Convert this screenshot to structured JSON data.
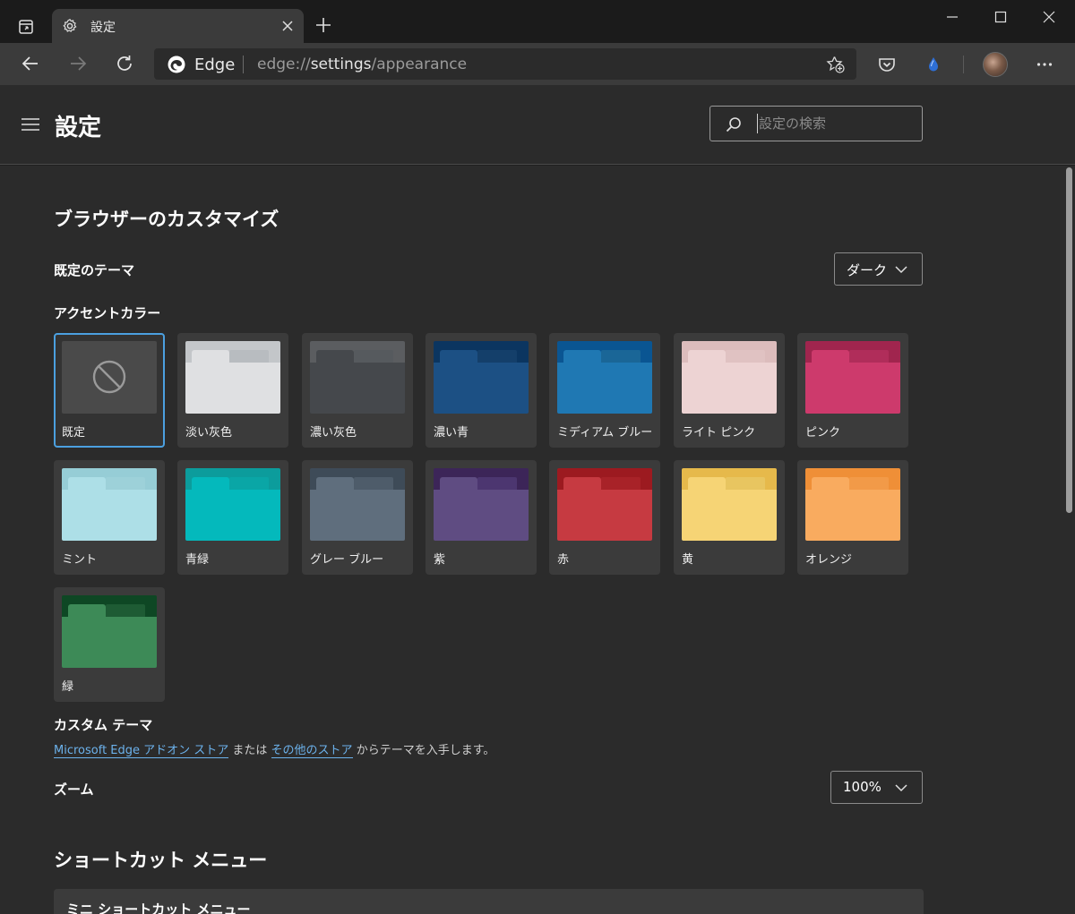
{
  "browser": {
    "tab_title": "設定",
    "brand": "Edge",
    "url_scheme": "edge://",
    "url_host": "settings",
    "url_path": "/appearance"
  },
  "header": {
    "title": "設定",
    "search_placeholder": "設定の検索"
  },
  "appearance": {
    "section_title": "ブラウザーのカスタマイズ",
    "theme_label": "既定のテーマ",
    "theme_value": "ダーク",
    "accent_label": "アクセントカラー",
    "accents": [
      {
        "label": "既定",
        "selected": true
      },
      {
        "label": "淡い灰色",
        "top": "#c3c6c9",
        "body": "#dfe0e2",
        "tab2": "#b8bcc0"
      },
      {
        "label": "濃い灰色",
        "top": "#5b5d60",
        "body": "#45484c",
        "tab2": "#565a5e"
      },
      {
        "label": "濃い青",
        "top": "#0b3560",
        "body": "#1c5084",
        "tab2": "#143f6a"
      },
      {
        "label": "ミディアム ブルー",
        "top": "#0a5592",
        "body": "#1f78b3",
        "tab2": "#1a6697"
      },
      {
        "label": "ライト ピンク",
        "top": "#dcbcbc",
        "body": "#edd3d3",
        "tab2": "#e0c2c2"
      },
      {
        "label": "ピンク",
        "top": "#a0254e",
        "body": "#cd3a6c",
        "tab2": "#b02d5a"
      },
      {
        "label": "ミント",
        "top": "#96cdd6",
        "body": "#addfe7",
        "tab2": "#9dd1d9"
      },
      {
        "label": "青緑",
        "top": "#0c9c9c",
        "body": "#04b9bc",
        "tab2": "#0aa6a6"
      },
      {
        "label": "グレー ブルー",
        "top": "#3e4b58",
        "body": "#5f6e7d",
        "tab2": "#4e5c6a"
      },
      {
        "label": "紫",
        "top": "#3c2558",
        "body": "#5f4c82",
        "tab2": "#4c3670"
      },
      {
        "label": "赤",
        "top": "#9c1a20",
        "body": "#c63a41",
        "tab2": "#a82228"
      },
      {
        "label": "黄",
        "top": "#e6b94b",
        "body": "#f6d475",
        "tab2": "#e8c560"
      },
      {
        "label": "オレンジ",
        "top": "#ef8f37",
        "body": "#f9ab5f",
        "tab2": "#f29a48"
      },
      {
        "label": "緑",
        "top": "#0e4724",
        "body": "#3d8a57",
        "tab2": "#1e5b34"
      }
    ],
    "custom_theme_label": "カスタム テーマ",
    "custom_link1": "Microsoft Edge アドオン ストア",
    "custom_mid": " または ",
    "custom_link2": "その他のストア",
    "custom_tail": " からテーマを入手します。",
    "zoom_label": "ズーム",
    "zoom_value": "100%"
  },
  "shortcut": {
    "section_title": "ショートカット メニュー",
    "mini_menu_label": "ミニ ショートカット メニュー"
  }
}
